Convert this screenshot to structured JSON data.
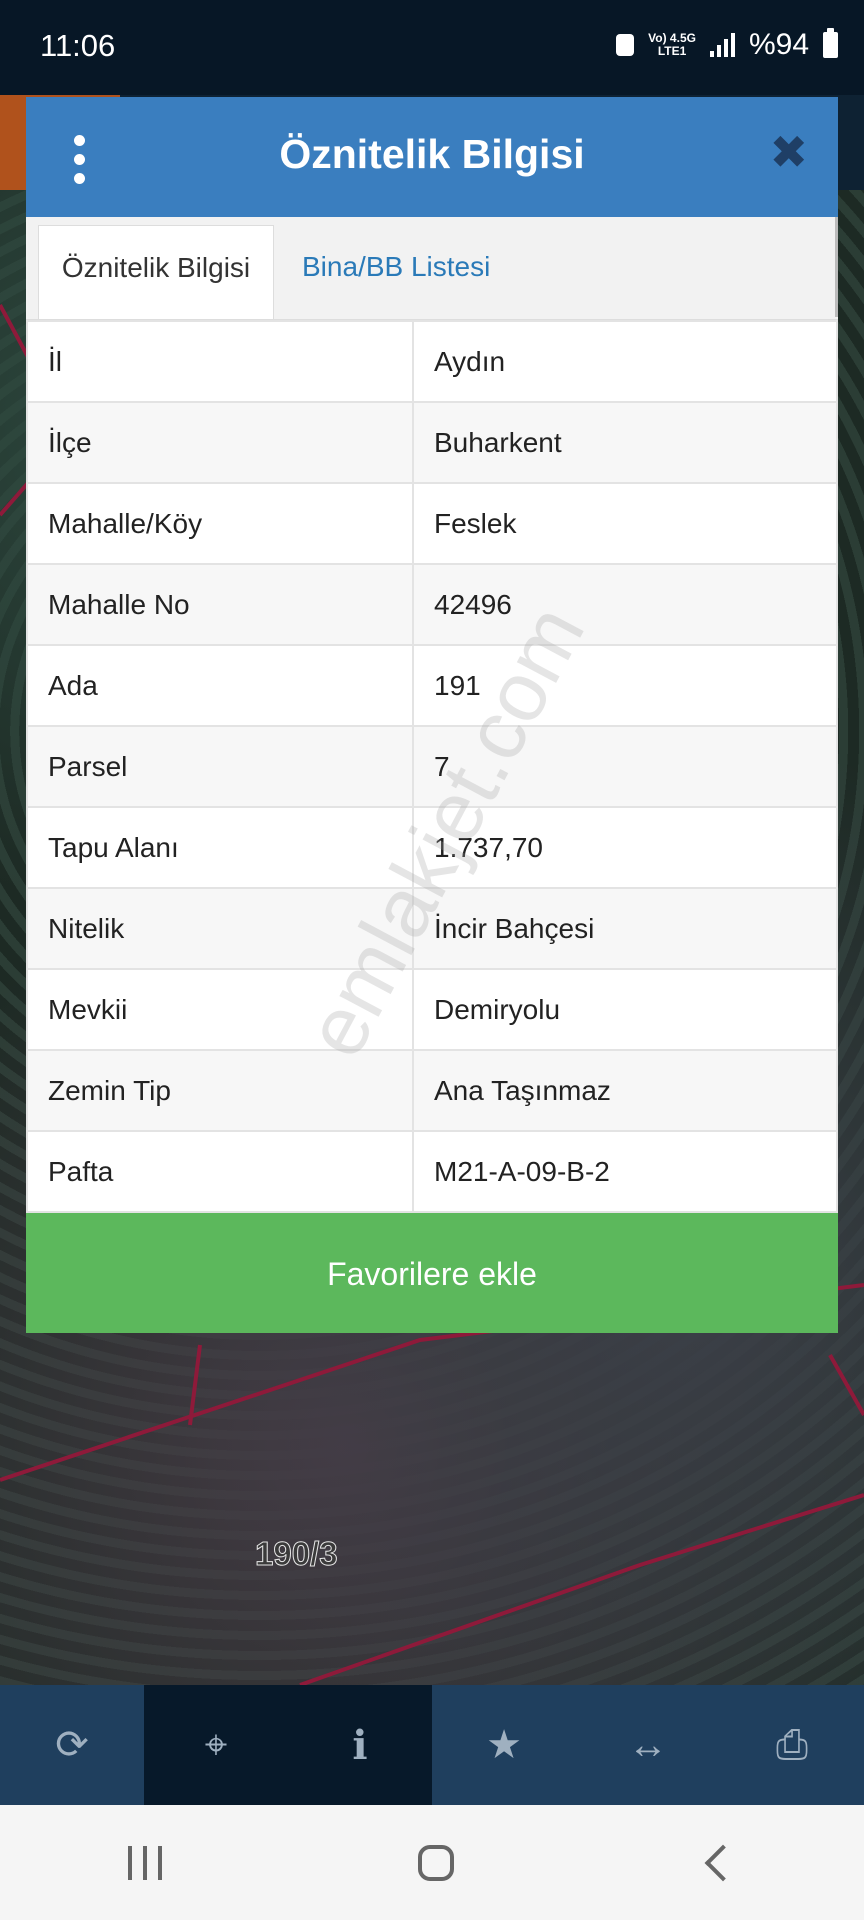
{
  "status_bar": {
    "time": "11:06",
    "network_top": "Vo) 4.5G",
    "network_bottom": "LTE1",
    "battery": "%94"
  },
  "dialog": {
    "title": "Öznitelik Bilgisi",
    "tabs": [
      {
        "label": "Öznitelik Bilgisi",
        "active": true
      },
      {
        "label": "Bina/BB Listesi",
        "active": false
      }
    ],
    "rows": [
      {
        "key": "İl",
        "value": "Aydın"
      },
      {
        "key": "İlçe",
        "value": "Buharkent"
      },
      {
        "key": "Mahalle/Köy",
        "value": "Feslek"
      },
      {
        "key": "Mahalle No",
        "value": "42496"
      },
      {
        "key": "Ada",
        "value": "191"
      },
      {
        "key": "Parsel",
        "value": "7"
      },
      {
        "key": "Tapu Alanı",
        "value": "1.737,70"
      },
      {
        "key": "Nitelik",
        "value": "İncir Bahçesi"
      },
      {
        "key": "Mevkii",
        "value": "Demiryolu"
      },
      {
        "key": "Zemin Tip",
        "value": "Ana Taşınmaz"
      },
      {
        "key": "Pafta",
        "value": "M21-A-09-B-2"
      }
    ],
    "favorite_button": "Favorilere ekle"
  },
  "watermark": "emlakjet.com",
  "map": {
    "parcel_label": "190/3"
  },
  "toolbar": {
    "items": [
      {
        "icon": "refresh-icon",
        "glyph": "⟳"
      },
      {
        "icon": "crosshair-icon",
        "glyph": "⌖"
      },
      {
        "icon": "info-icon",
        "glyph": "i"
      },
      {
        "icon": "star-icon",
        "glyph": "★"
      },
      {
        "icon": "measure-icon",
        "glyph": "↔"
      },
      {
        "icon": "print-icon",
        "glyph": "⎙"
      }
    ]
  },
  "colors": {
    "header": "#3a7ebf",
    "favorite_button": "#5cb85c",
    "toolbar": "#1f3f5e",
    "toolbar_active": "#07192a",
    "tab_link": "#2a7ab8"
  }
}
